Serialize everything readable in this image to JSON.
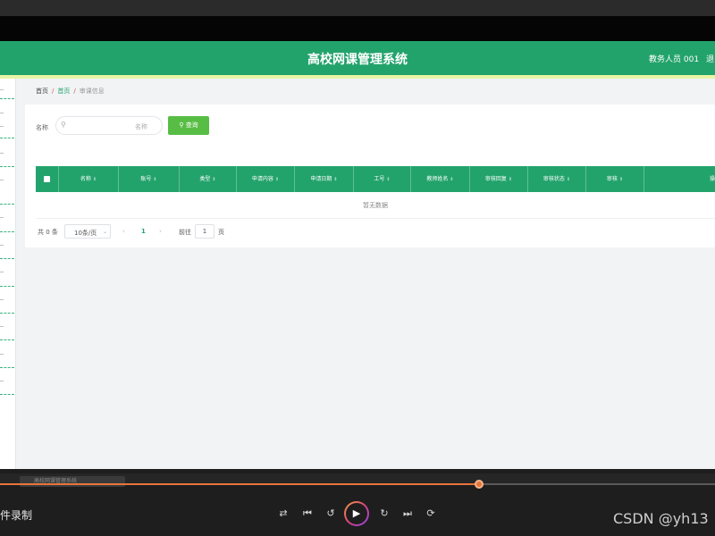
{
  "header": {
    "title": "高校网课管理系统",
    "user": "教务人员 001",
    "logout": "退"
  },
  "breadcrumb": {
    "home": "首页",
    "link": "首页",
    "current": "审课信息"
  },
  "search": {
    "label": "名称",
    "placeholder": "名称",
    "button": "查询"
  },
  "table": {
    "columns": [
      "名称",
      "账号",
      "类型",
      "申请内容",
      "申请日期",
      "工号",
      "教师姓名",
      "审核回复",
      "审核状态",
      "审核",
      "操"
    ],
    "empty_text": "暂无数据"
  },
  "pagination": {
    "total": "共 0 条",
    "page_size": "10条/页",
    "current_page": "1",
    "goto_label": "前往",
    "goto_value": "1",
    "page_word": "页"
  },
  "player": {
    "file_name": "高校网课管理系统",
    "recording_label": "件录制",
    "progress": 0.67,
    "watermark": "CSDN @yh13"
  },
  "icons": {
    "search": "search-icon",
    "shuffle": "shuffle-icon",
    "prev": "skip-back-icon",
    "rewind": "rewind-10-icon",
    "play": "play-icon",
    "forward": "forward-30-icon",
    "next": "skip-forward-icon",
    "repeat": "repeat-icon"
  },
  "colors": {
    "brand_green": "#23a36c",
    "search_button": "#58bd44",
    "accent": "#e7f4a6",
    "progress": "#e8743b"
  }
}
